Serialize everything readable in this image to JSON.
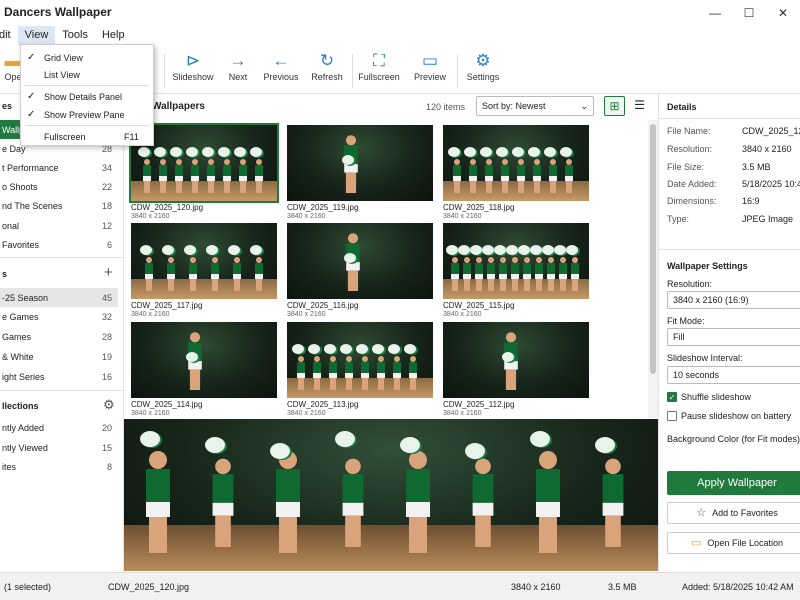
{
  "window": {
    "title": "s Dancers Wallpaper",
    "controls": [
      "—",
      "☐",
      "✕"
    ]
  },
  "menubar": [
    "dit",
    "View",
    "Tools",
    "Help"
  ],
  "view_menu": {
    "items": [
      {
        "label": "Grid View",
        "checked": true,
        "shortcut": ""
      },
      {
        "label": "List View",
        "checked": false,
        "shortcut": ""
      },
      {
        "label": "Show Details Panel",
        "checked": true,
        "shortcut": ""
      },
      {
        "label": "Show Preview Pane",
        "checked": true,
        "shortcut": ""
      },
      {
        "label": "Fullscreen",
        "checked": false,
        "shortcut": "F11"
      }
    ]
  },
  "toolbar": {
    "open": "Ope",
    "partial": "e",
    "slideshow": "Slideshow",
    "next": "Next",
    "previous": "Previous",
    "refresh": "Refresh",
    "fullscreen": "Fullscreen",
    "preview": "Preview",
    "settings": "Settings"
  },
  "sidebar": {
    "section1_header": "es",
    "section1": [
      {
        "label": "Wallp",
        "count": ""
      },
      {
        "label": "e Day",
        "count": "28"
      },
      {
        "label": "t Performance",
        "count": "34"
      },
      {
        "label": "o Shoots",
        "count": "22"
      },
      {
        "label": "nd The Scenes",
        "count": "18"
      },
      {
        "label": "onal",
        "count": "12"
      },
      {
        "label": "Favorites",
        "count": "6"
      }
    ],
    "section2_header": "s",
    "section2": [
      {
        "label": "-25 Season",
        "count": "45"
      },
      {
        "label": "e Games",
        "count": "32"
      },
      {
        "label": " Games",
        "count": "28"
      },
      {
        "label": "& White",
        "count": "19"
      },
      {
        "label": "ight Series",
        "count": "16"
      }
    ],
    "section3_header": "llections",
    "section3": [
      {
        "label": "ntly Added",
        "count": "20"
      },
      {
        "label": "ntly Viewed",
        "count": "15"
      },
      {
        "label": "ites",
        "count": "8"
      }
    ]
  },
  "gallery": {
    "title": "Wallpapers",
    "count": "120 items",
    "sort_label": "Sort by: Newest",
    "items": [
      {
        "name": "CDW_2025_120.jpg",
        "dims": "3840 x 2160"
      },
      {
        "name": "CDW_2025_119.jpg",
        "dims": "3840 x 2160"
      },
      {
        "name": "CDW_2025_118.jpg",
        "dims": "3840 x 2160"
      },
      {
        "name": "CDW_2025_117.jpg",
        "dims": "3840 x 2160"
      },
      {
        "name": "CDW_2025_116.jpg",
        "dims": "3840 x 2160"
      },
      {
        "name": "CDW_2025_115.jpg",
        "dims": "3840 x 2160"
      },
      {
        "name": "CDW_2025_114.jpg",
        "dims": "3840 x 2160"
      },
      {
        "name": "CDW_2025_113.jpg",
        "dims": "3840 x 2160"
      },
      {
        "name": "CDW_2025_112.jpg",
        "dims": "3840 x 2160"
      }
    ]
  },
  "details": {
    "header": "Details",
    "rows": [
      {
        "key": "File Name:",
        "value": "CDW_2025_120"
      },
      {
        "key": "Resolution:",
        "value": "3840 x 2160"
      },
      {
        "key": "File Size:",
        "value": "3.5 MB"
      },
      {
        "key": "Date Added:",
        "value": "5/18/2025 10:4"
      },
      {
        "key": "Dimensions:",
        "value": "16:9"
      },
      {
        "key": "Type:",
        "value": "JPEG Image"
      }
    ]
  },
  "settings": {
    "header": "Wallpaper Settings",
    "resolution_label": "Resolution:",
    "resolution_value": "3840 x 2160 (16:9)",
    "fit_label": "Fit Mode:",
    "fit_value": "Fill",
    "interval_label": "Slideshow Interval:",
    "interval_value": "10 seconds",
    "shuffle_label": "Shuffle slideshow",
    "pause_label": "Pause slideshow on battery",
    "bg_label": "Background Color (for Fit modes):",
    "apply_button": "Apply Wallpaper",
    "favorites_button": "Add to Favorites",
    "open_location_button": "Open File Location"
  },
  "statusbar": {
    "selected": "(1 selected)",
    "filename": "CDW_2025_120.jpg",
    "resolution": "3840 x 2160",
    "size": "3.5 MB",
    "added": "Added: 5/18/2025 10:42 AM"
  },
  "colors": {
    "accent": "#217a3d",
    "toolbar_icon": "#2b7fd1"
  }
}
